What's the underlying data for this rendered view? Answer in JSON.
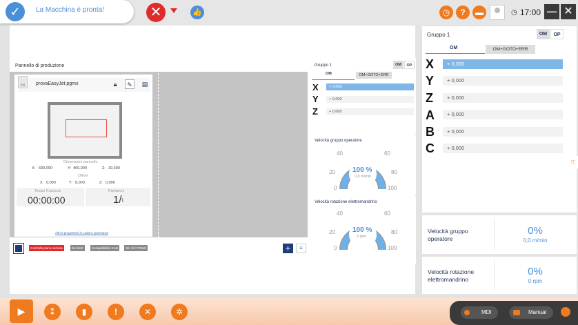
{
  "status": {
    "message": "La Macchina è pronta!"
  },
  "topbar": {
    "stop_glyph": "✕",
    "like_glyph": "👍",
    "clock": "17:00",
    "minimize_glyph": "—",
    "close_glyph": "✕"
  },
  "production": {
    "title": "Pannello di produzione",
    "file_name": "provaEasyJet.pgmx",
    "file_icon_label": "AB",
    "dimensions_label": "Dimensioni pannello",
    "dim_x_label": "X:",
    "dim_x": "600,000",
    "dim_y_label": "Y:",
    "dim_y": "400,000",
    "dim_z_label": "Z:",
    "dim_z": "19,300",
    "offset_label": "Offset",
    "off_x_label": "X:",
    "off_x": "0,000",
    "off_y_label": "Y:",
    "off_y": "0,000",
    "off_z_label": "Z:",
    "off_z": "0,000",
    "time_label": "Tempo Trascorso",
    "time_value": "00:00:00",
    "rep_label": "Ripetizioni",
    "rep_value": "1/",
    "rep_total": "1",
    "queue_link": "Altri 0 programmi in coda in quest'area",
    "tags": [
      "Controllo piano esclusa",
      "No Start",
      "Compatibilità: CAD",
      "Str. Cd: PGMX"
    ],
    "plus": "+",
    "list": "≡"
  },
  "group_mid": {
    "title": "Gruppo 1",
    "seg_om": "OM",
    "seg_op": "OP",
    "tab_om": "OM",
    "tab_goto": "OM+GOTO+ERR",
    "axes": [
      {
        "name": "X",
        "value": "+ 0,000"
      },
      {
        "name": "Y",
        "value": "+ 0,000"
      },
      {
        "name": "Z",
        "value": "+ 0,000"
      }
    ]
  },
  "gauge_operator": {
    "title": "Velocità gruppo operatore",
    "ticks": [
      "0",
      "20",
      "40",
      "60",
      "80",
      "100"
    ],
    "percent": "100 %",
    "sub": "0,0 m/min",
    "level": 1.0
  },
  "gauge_spindle": {
    "title": "Velocità rotazione elettromandrino",
    "ticks": [
      "0",
      "20",
      "40",
      "60",
      "80",
      "100"
    ],
    "percent": "100 %",
    "sub": "0 rpm",
    "level": 1.0
  },
  "group_right": {
    "title": "Gruppo 1",
    "seg_om": "OM",
    "seg_op": "OP",
    "tab_om": "OM",
    "tab_goto": "OM+GOTO+ERR",
    "axes": [
      {
        "name": "X",
        "value": "+ 0,000"
      },
      {
        "name": "Y",
        "value": "+ 0,000"
      },
      {
        "name": "Z",
        "value": "+ 0,000"
      },
      {
        "name": "A",
        "value": "+ 0,000"
      },
      {
        "name": "B",
        "value": "+ 0,000"
      },
      {
        "name": "C",
        "value": "+ 0,000"
      }
    ]
  },
  "speed_operator": {
    "label": "Velocità gruppo operatore",
    "value": "0%",
    "unit": "0,0 m/min"
  },
  "speed_spindle": {
    "label": "Velocità rotazione elettromandrino",
    "value": "0%",
    "unit": "0 rpm"
  },
  "bottom": {
    "mdi": "MDI",
    "manual": "Manual"
  },
  "colors": {
    "accent": "#4a90d9",
    "orange": "#f07a1e",
    "stop": "#e02b2b",
    "navy": "#1f3c7a"
  }
}
